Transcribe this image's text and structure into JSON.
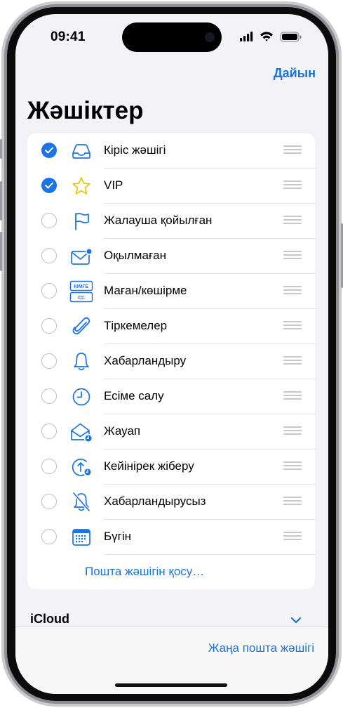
{
  "status_bar": {
    "time": "09:41"
  },
  "nav": {
    "done_label": "Дайын"
  },
  "page": {
    "title": "Жәшіктер"
  },
  "mailboxes": [
    {
      "label": "Кіріс жәшігі",
      "checked": true,
      "icon": "tray-icon"
    },
    {
      "label": "VIP",
      "checked": true,
      "icon": "star-icon"
    },
    {
      "label": "Жалауша қойылған",
      "checked": false,
      "icon": "flag-icon"
    },
    {
      "label": "Оқылмаған",
      "checked": false,
      "icon": "unread-envelope-icon"
    },
    {
      "label": "Маған/көшірме",
      "checked": false,
      "icon": "to-cc-icon",
      "icon_text": [
        "КІМГЕ",
        "СС"
      ]
    },
    {
      "label": "Тіркемелер",
      "checked": false,
      "icon": "paperclip-icon"
    },
    {
      "label": "Хабарландыру",
      "checked": false,
      "icon": "bell-icon"
    },
    {
      "label": "Есіме салу",
      "checked": false,
      "icon": "clock-icon"
    },
    {
      "label": "Жауап",
      "checked": false,
      "icon": "reply-envelope-icon"
    },
    {
      "label": "Кейінірек жіберу",
      "checked": false,
      "icon": "send-later-icon"
    },
    {
      "label": "Хабарландырусыз",
      "checked": false,
      "icon": "bell-slash-icon"
    },
    {
      "label": "Бүгін",
      "checked": false,
      "icon": "calendar-icon"
    }
  ],
  "add_mailbox_label": "Пошта жәшігін қосу…",
  "section": {
    "icloud_label": "iCloud"
  },
  "toolbar": {
    "new_mailbox_label": "Жаңа пошта жәшігі"
  },
  "colors": {
    "accent": "#1a73d9",
    "background": "#f2f2f7"
  }
}
